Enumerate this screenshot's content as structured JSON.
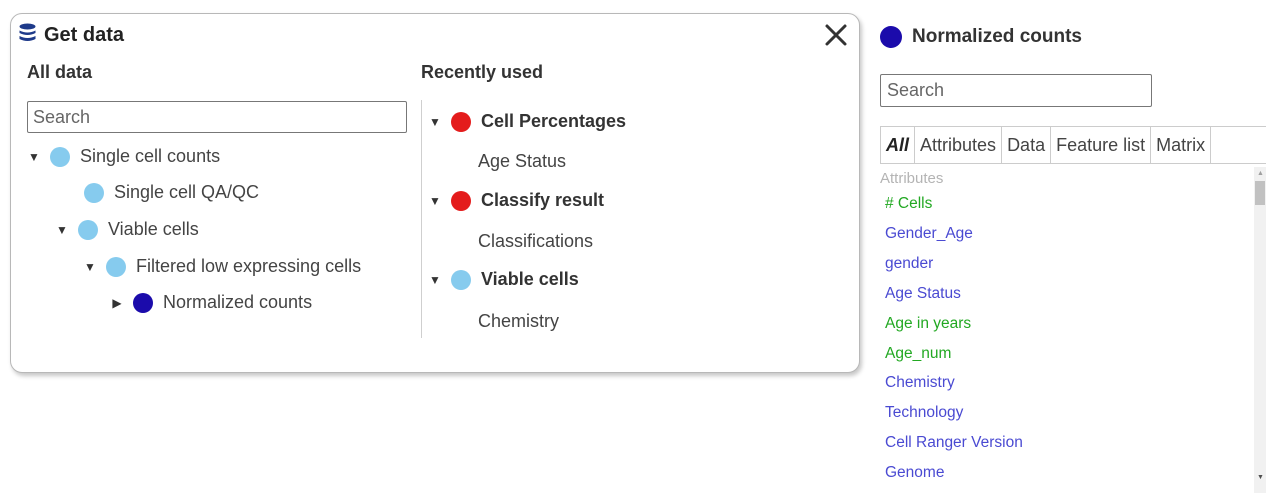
{
  "get_data": {
    "title": "Get data",
    "all_data_label": "All data",
    "recently_used_label": "Recently used",
    "search_placeholder": "Search",
    "tree": [
      {
        "label": "Single cell counts"
      },
      {
        "label": "Single cell QA/QC"
      },
      {
        "label": "Viable cells"
      },
      {
        "label": "Filtered low expressing cells"
      },
      {
        "label": "Normalized counts"
      }
    ],
    "recent": [
      {
        "label": "Cell Percentages",
        "child": "Age Status"
      },
      {
        "label": "Classify result",
        "child": "Classifications"
      },
      {
        "label": "Viable cells",
        "child": "Chemistry"
      }
    ]
  },
  "node_panel": {
    "title": "Normalized counts",
    "search_placeholder": "Search",
    "tabs": [
      "All",
      "Attributes",
      "Data",
      "Feature list",
      "Matrix"
    ],
    "group_label": "Attributes",
    "items": [
      {
        "label": "# Cells",
        "color": "#22a822"
      },
      {
        "label": "Gender_Age",
        "color": "#4a4ad2"
      },
      {
        "label": "gender",
        "color": "#4a4ad2"
      },
      {
        "label": "Age Status",
        "color": "#4a4ad2"
      },
      {
        "label": "Age in years",
        "color": "#22a822"
      },
      {
        "label": "Age_num",
        "color": "#22a822"
      },
      {
        "label": "Chemistry",
        "color": "#4a4ad2"
      },
      {
        "label": "Technology",
        "color": "#4a4ad2"
      },
      {
        "label": "Cell Ranger Version",
        "color": "#4a4ad2"
      },
      {
        "label": "Genome",
        "color": "#4a4ad2"
      }
    ]
  },
  "colors": {
    "light_node": "#86cbee",
    "red_node": "#e41c1c",
    "navy_node": "#1b0bab",
    "categorical_attr": "#4a4ad2",
    "numeric_attr": "#22a822"
  }
}
